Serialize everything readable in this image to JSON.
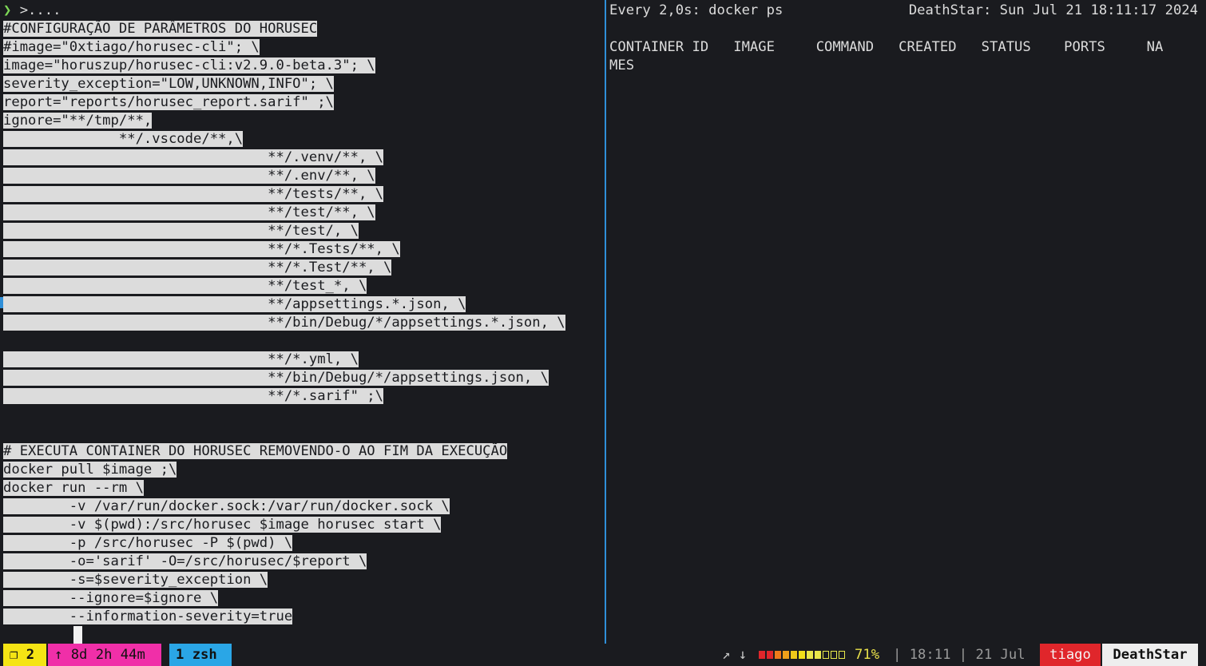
{
  "left_pane": {
    "prompt_arrow": "❯",
    "prompt_text": " >....",
    "lines": [
      {
        "text": "#CONFIGURAÇÃO DE PARÂMETROS DO HORUSEC",
        "indent": 0
      },
      {
        "text": "#image=\"0xtiago/horusec-cli\"; \\",
        "indent": 0
      },
      {
        "text": "image=\"horuszup/horusec-cli:v2.9.0-beta.3\"; \\",
        "indent": 0
      },
      {
        "text": "severity_exception=\"LOW,UNKNOWN,INFO\"; \\",
        "indent": 0
      },
      {
        "text": "report=\"reports/horusec_report.sarif\" ;\\",
        "indent": 0
      },
      {
        "text": "ignore=\"**/tmp/**,",
        "indent": 0
      },
      {
        "text": "**/.vscode/**,\\",
        "indent": 14
      },
      {
        "text": "**/.venv/**, \\",
        "indent": 32
      },
      {
        "text": "**/.env/**, \\",
        "indent": 32
      },
      {
        "text": "**/tests/**, \\",
        "indent": 32
      },
      {
        "text": "**/test/**, \\",
        "indent": 32
      },
      {
        "text": "**/test/, \\",
        "indent": 32
      },
      {
        "text": "**/*.Tests/**, \\",
        "indent": 32
      },
      {
        "text": "**/*.Test/**, \\",
        "indent": 32
      },
      {
        "text": "**/test_*, \\",
        "indent": 32
      },
      {
        "text": "**/appsettings.*.json, \\",
        "indent": 32
      },
      {
        "text": "**/bin/Debug/*/appsettings.*.json, \\",
        "indent": 32
      },
      {
        "text": "",
        "indent": 0
      },
      {
        "text": "**/*.yml, \\",
        "indent": 32
      },
      {
        "text": "**/bin/Debug/*/appsettings.json, \\",
        "indent": 32
      },
      {
        "text": "**/*.sarif\" ;\\",
        "indent": 32
      },
      {
        "text": "",
        "indent": 0
      },
      {
        "text": "",
        "indent": 0
      },
      {
        "text": "# EXECUTA CONTAINER DO HORUSEC REMOVENDO-O AO FIM DA EXECUÇÃO",
        "indent": 0
      },
      {
        "text": "docker pull $image ;\\",
        "indent": 0
      },
      {
        "text": "docker run --rm \\",
        "indent": 0
      },
      {
        "text": "-v /var/run/docker.sock:/var/run/docker.sock \\",
        "indent": 8
      },
      {
        "text": "-v $(pwd):/src/horusec $image horusec start \\",
        "indent": 8
      },
      {
        "text": "-p /src/horusec -P $(pwd) \\",
        "indent": 8
      },
      {
        "text": "-o='sarif' -O=/src/horusec/$report \\",
        "indent": 8
      },
      {
        "text": "-s=$severity_exception \\",
        "indent": 8
      },
      {
        "text": "--ignore=$ignore \\",
        "indent": 8
      },
      {
        "text": "--information-severity=true",
        "indent": 8
      }
    ]
  },
  "right_pane": {
    "watch_command": "Every 2,0s: docker ps",
    "watch_host_time": "DeathStar: Sun Jul 21 18:11:17 2024",
    "header_line": "CONTAINER ID   IMAGE     COMMAND   CREATED   STATUS    PORTS     NA",
    "header_wrap": "MES"
  },
  "status_bar": {
    "window_index": "❐ 2",
    "uptime": "↑ 8d 2h 44m",
    "shell_tab": "1 zsh",
    "arrows": "↗ ↓",
    "battery_percent": "71%",
    "battery_level": 0.71,
    "battery_cells": [
      "#e0262b",
      "#e0262b",
      "#f07a1a",
      "#f0a01a",
      "#f0c81a",
      "#f0e01a",
      "#e8e84a",
      "#e8e84a",
      "empty",
      "empty",
      "empty"
    ],
    "time": "| 18:11 | 21 Jul",
    "user": "tiago",
    "host": "DeathStar"
  },
  "colors": {
    "background": "#1a1b1f",
    "selection": "#dcdcdc",
    "divider": "#2f8fd8"
  }
}
